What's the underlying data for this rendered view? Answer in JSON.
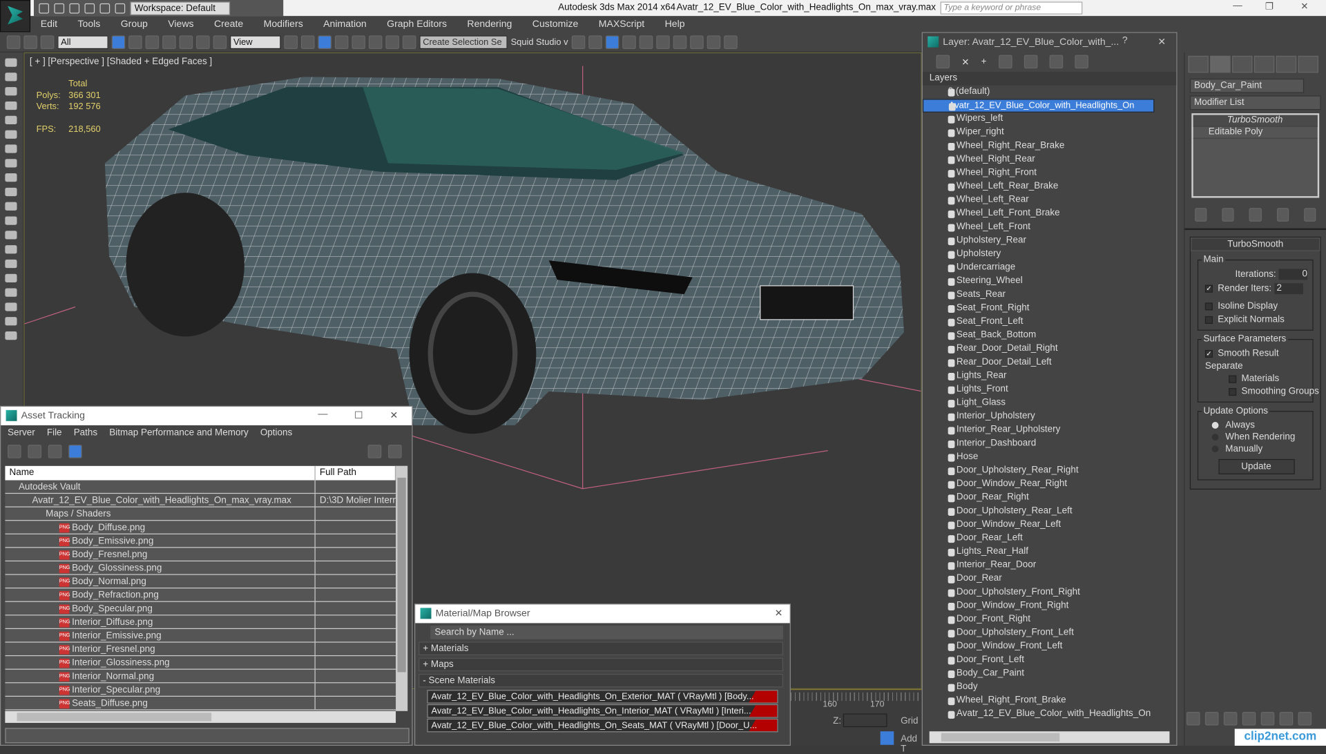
{
  "app": {
    "title": "Autodesk 3ds Max  2014 x64",
    "file": "Avatr_12_EV_Blue_Color_with_Headlights_On_max_vray.max",
    "workspace": "Workspace: Default",
    "search_placeholder": "Type a keyword or phrase"
  },
  "menu": [
    "Edit",
    "Tools",
    "Group",
    "Views",
    "Create",
    "Modifiers",
    "Animation",
    "Graph Editors",
    "Rendering",
    "Customize",
    "MAXScript",
    "Help"
  ],
  "toolbar": {
    "filter": "All",
    "coord": "View",
    "selection_set": "Create Selection Se",
    "squid": "Squid Studio v"
  },
  "viewport": {
    "label": "[ + ] [Perspective ] [Shaded + Edged Faces ]",
    "total": "Total",
    "polys_label": "Polys:",
    "polys": "366 301",
    "verts_label": "Verts:",
    "verts": "192 576",
    "fps_label": "FPS:",
    "fps": "218,560"
  },
  "asset_tracking": {
    "title": "Asset Tracking",
    "menu": [
      "Server",
      "File",
      "Paths",
      "Bitmap Performance and Memory",
      "Options"
    ],
    "col_name": "Name",
    "col_path": "Full Path",
    "rows": [
      {
        "name": "Autodesk Vault",
        "path": "",
        "level": 1
      },
      {
        "name": "Avatr_12_EV_Blue_Color_with_Headlights_On_max_vray.max",
        "path": "D:\\3D Molier Intern",
        "level": 2
      },
      {
        "name": "Maps / Shaders",
        "path": "",
        "level": 3
      },
      {
        "name": "Body_Diffuse.png",
        "path": "",
        "level": 4
      },
      {
        "name": "Body_Emissive.png",
        "path": "",
        "level": 4
      },
      {
        "name": "Body_Fresnel.png",
        "path": "",
        "level": 4
      },
      {
        "name": "Body_Glossiness.png",
        "path": "",
        "level": 4
      },
      {
        "name": "Body_Normal.png",
        "path": "",
        "level": 4
      },
      {
        "name": "Body_Refraction.png",
        "path": "",
        "level": 4
      },
      {
        "name": "Body_Specular.png",
        "path": "",
        "level": 4
      },
      {
        "name": "Interior_Diffuse.png",
        "path": "",
        "level": 4
      },
      {
        "name": "Interior_Emissive.png",
        "path": "",
        "level": 4
      },
      {
        "name": "Interior_Fresnel.png",
        "path": "",
        "level": 4
      },
      {
        "name": "Interior_Glossiness.png",
        "path": "",
        "level": 4
      },
      {
        "name": "Interior_Normal.png",
        "path": "",
        "level": 4
      },
      {
        "name": "Interior_Specular.png",
        "path": "",
        "level": 4
      },
      {
        "name": "Seats_Diffuse.png",
        "path": "",
        "level": 4
      }
    ]
  },
  "material_browser": {
    "title": "Material/Map Browser",
    "search_placeholder": "Search by Name ...",
    "materials": "+ Materials",
    "maps": "+ Maps",
    "scene": "- Scene Materials",
    "items": [
      "Avatr_12_EV_Blue_Color_with_Headlights_On_Exterior_MAT ( VRayMtl ) [Body...",
      "Avatr_12_EV_Blue_Color_with_Headlights_On_Interior_MAT ( VRayMtl ) [Interi...",
      "Avatr_12_EV_Blue_Color_with_Headlights_On_Seats_MAT ( VRayMtl ) [Door_U..."
    ]
  },
  "timeline": {
    "tick160": "160",
    "tick170": "170",
    "z_label": "Z:",
    "grid": "Grid",
    "add": "Add T"
  },
  "layers": {
    "title": "Layer: Avatr_12_EV_Blue_Color_with_...",
    "header": "Layers",
    "default": "0 (default)",
    "selected": "Avatr_12_EV_Blue_Color_with_Headlights_On",
    "items": [
      "Wipers_left",
      "Wiper_right",
      "Wheel_Right_Rear_Brake",
      "Wheel_Right_Rear",
      "Wheel_Right_Front",
      "Wheel_Left_Rear_Brake",
      "Wheel_Left_Rear",
      "Wheel_Left_Front_Brake",
      "Wheel_Left_Front",
      "Upholstery_Rear",
      "Upholstery",
      "Undercarriage",
      "Steering_Wheel",
      "Seats_Rear",
      "Seat_Front_Right",
      "Seat_Front_Left",
      "Seat_Back_Bottom",
      "Rear_Door_Detail_Right",
      "Rear_Door_Detail_Left",
      "Lights_Rear",
      "Lights_Front",
      "Light_Glass",
      "Interior_Upholstery",
      "Interior_Rear_Upholstery",
      "Interior_Dashboard",
      "Hose",
      "Door_Upholstery_Rear_Right",
      "Door_Window_Rear_Right",
      "Door_Rear_Right",
      "Door_Upholstery_Rear_Left",
      "Door_Window_Rear_Left",
      "Door_Rear_Left",
      "Lights_Rear_Half",
      "Interior_Rear_Door",
      "Door_Rear",
      "Door_Upholstery_Front_Right",
      "Door_Window_Front_Right",
      "Door_Front_Right",
      "Door_Upholstery_Front_Left",
      "Door_Window_Front_Left",
      "Door_Front_Left",
      "Body_Car_Paint",
      "Body",
      "Wheel_Right_Front_Brake",
      "Avatr_12_EV_Blue_Color_with_Headlights_On"
    ]
  },
  "command_panel": {
    "object_name": "Body_Car_Paint",
    "modifier_list": "Modifier List",
    "stack": [
      "TurboSmooth",
      "Editable Poly"
    ],
    "rollout": "TurboSmooth",
    "main": "Main",
    "iterations_label": "Iterations:",
    "iterations": "0",
    "render_iters_label": "Render Iters:",
    "render_iters": "2",
    "isoline": "Isoline Display",
    "explicit": "Explicit Normals",
    "surface": "Surface Parameters",
    "smooth_result": "Smooth Result",
    "separate": "Separate",
    "materials": "Materials",
    "smoothing_groups": "Smoothing Groups",
    "update_options": "Update Options",
    "always": "Always",
    "when_rendering": "When Rendering",
    "manually": "Manually",
    "update": "Update"
  },
  "watermark": "clip2net.com"
}
